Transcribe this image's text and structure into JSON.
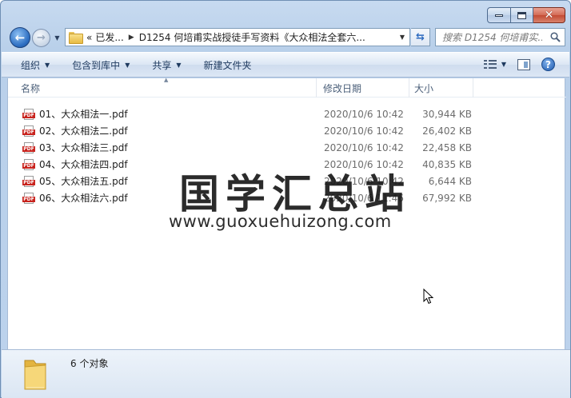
{
  "window": {
    "caption": {
      "close_glyph": "✕"
    }
  },
  "address": {
    "overflow": "«",
    "crumbs": [
      "已发...",
      "D1254 何培甫实战授徒手写资料《大众相法全套六..."
    ]
  },
  "search": {
    "placeholder": "搜索 D1254 何培甫实..."
  },
  "toolbar": {
    "organize": "组织",
    "include_in_library": "包含到库中",
    "share": "共享",
    "new_folder": "新建文件夹",
    "help_glyph": "?"
  },
  "columns": {
    "name": "名称",
    "date": "修改日期",
    "size": "大小"
  },
  "files": [
    {
      "name": "01、大众相法一.pdf",
      "date": "2020/10/6 10:42",
      "size": "30,944 KB"
    },
    {
      "name": "02、大众相法二.pdf",
      "date": "2020/10/6 10:42",
      "size": "26,402 KB"
    },
    {
      "name": "03、大众相法三.pdf",
      "date": "2020/10/6 10:42",
      "size": "22,458 KB"
    },
    {
      "name": "04、大众相法四.pdf",
      "date": "2020/10/6 10:42",
      "size": "40,835 KB"
    },
    {
      "name": "05、大众相法五.pdf",
      "date": "2020/10/6 10:42",
      "size": "6,644 KB"
    },
    {
      "name": "06、大众相法六.pdf",
      "date": "2020/10/6 11:46",
      "size": "67,992 KB"
    }
  ],
  "file_icon_label": "PDF",
  "watermark": {
    "cn": "国学汇总站",
    "url": "www.guoxuehuizong.com"
  },
  "status": {
    "count": "6 个对象"
  },
  "icons": {
    "back": "back-arrow-icon",
    "forward": "forward-arrow-icon",
    "refresh": "refresh-icon",
    "search": "search-icon",
    "pdf": "pdf-file-icon",
    "folder": "folder-icon"
  }
}
